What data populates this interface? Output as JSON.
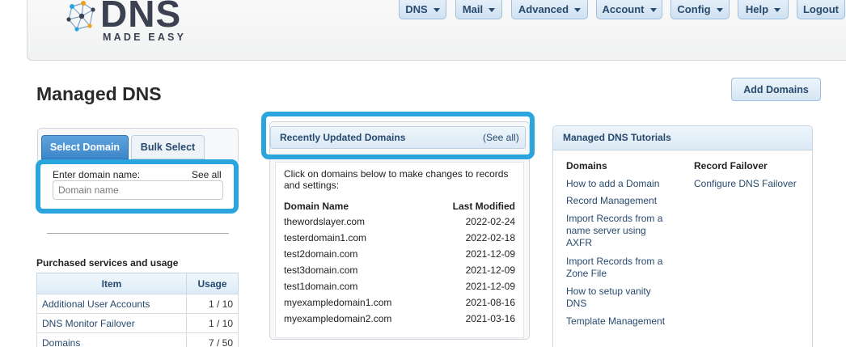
{
  "logo": {
    "main": "DNS",
    "sub": "MADE EASY"
  },
  "nav": [
    {
      "label": "DNS",
      "has_caret": true
    },
    {
      "label": "Mail",
      "has_caret": true
    },
    {
      "label": "Advanced",
      "has_caret": true
    },
    {
      "label": "Account",
      "has_caret": true
    },
    {
      "label": "Config",
      "has_caret": true
    },
    {
      "label": "Help",
      "has_caret": true
    },
    {
      "label": "Logout",
      "has_caret": false
    }
  ],
  "page": {
    "title": "Managed DNS",
    "add_button": "Add Domains"
  },
  "select_domain": {
    "tab_active": "Select Domain",
    "tab_bulk": "Bulk Select",
    "enter_label": "Enter domain name:",
    "see_all": "See all",
    "placeholder": "Domain name"
  },
  "services": {
    "title": "Purchased services and usage",
    "headers": {
      "item": "Item",
      "usage": "Usage"
    },
    "rows": [
      {
        "item": "Additional User Accounts",
        "usage": "1 / 10"
      },
      {
        "item": "DNS Monitor Failover",
        "usage": "1 / 10"
      },
      {
        "item": "Domains",
        "usage": "7 / 50"
      }
    ]
  },
  "recent": {
    "title": "Recently Updated Domains",
    "see_all": "(See all)",
    "intro": "Click on domains below to make changes to records and settings:",
    "headers": {
      "name": "Domain Name",
      "modified": "Last Modified"
    },
    "rows": [
      {
        "name": "thewordslayer.com",
        "modified": "2022-02-24"
      },
      {
        "name": "testerdomain1.com",
        "modified": "2022-02-18"
      },
      {
        "name": "test2domain.com",
        "modified": "2021-12-09"
      },
      {
        "name": "test3domain.com",
        "modified": "2021-12-09"
      },
      {
        "name": "test1domain.com",
        "modified": "2021-12-09"
      },
      {
        "name": "myexampledomain1.com",
        "modified": "2021-08-16"
      },
      {
        "name": "myexampledomain2.com",
        "modified": "2021-03-16"
      }
    ]
  },
  "tutorials": {
    "title": "Managed DNS Tutorials",
    "domains_head": "Domains",
    "failover_head": "Record Failover",
    "domains_links": [
      "How to add a Domain",
      "Record Management",
      "Import Records from a name server using AXFR",
      "Import Records from a Zone File",
      "How to setup vanity DNS",
      "Template Management"
    ],
    "failover_links": [
      "Configure DNS Failover"
    ]
  },
  "colors": {
    "highlight": "#2aa5dd",
    "accent": "#3d86c9",
    "link": "#274a6e"
  }
}
